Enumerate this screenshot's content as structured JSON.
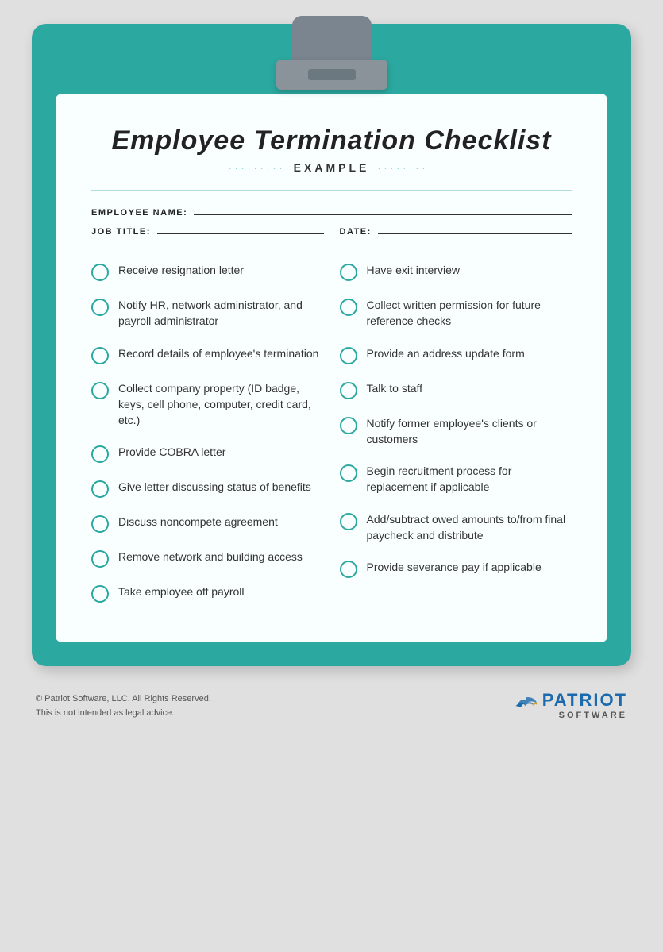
{
  "page": {
    "title": "Employee Termination Checklist",
    "subtitle": "EXAMPLE",
    "dots": "·········",
    "background_color": "#e0e0e0",
    "teal_color": "#2ba8a0"
  },
  "form_fields": {
    "employee_name_label": "EMPLOYEE NAME:",
    "job_title_label": "JOB TITLE:",
    "date_label": "DATE:"
  },
  "checklist": {
    "left_column": [
      {
        "id": "item-1",
        "text": "Receive resignation letter"
      },
      {
        "id": "item-2",
        "text": "Notify HR, network administrator, and payroll administrator"
      },
      {
        "id": "item-3",
        "text": "Record details of employee's termination"
      },
      {
        "id": "item-4",
        "text": "Collect company property (ID badge, keys, cell phone, computer, credit card, etc.)"
      },
      {
        "id": "item-5",
        "text": "Provide COBRA letter"
      },
      {
        "id": "item-6",
        "text": "Give letter discussing status of benefits"
      },
      {
        "id": "item-7",
        "text": "Discuss noncompete agreement"
      },
      {
        "id": "item-8",
        "text": "Remove network and building access"
      },
      {
        "id": "item-9",
        "text": "Take employee off payroll"
      }
    ],
    "right_column": [
      {
        "id": "item-10",
        "text": "Have exit interview"
      },
      {
        "id": "item-11",
        "text": "Collect written permission for future reference checks"
      },
      {
        "id": "item-12",
        "text": "Provide an address update form"
      },
      {
        "id": "item-13",
        "text": "Talk to staff"
      },
      {
        "id": "item-14",
        "text": "Notify former employee's clients or customers"
      },
      {
        "id": "item-15",
        "text": "Begin recruitment process for replacement if applicable"
      },
      {
        "id": "item-16",
        "text": "Add/subtract owed amounts to/from final paycheck and distribute"
      },
      {
        "id": "item-17",
        "text": "Provide severance pay if applicable"
      }
    ]
  },
  "footer": {
    "copyright": "© Patriot Software, LLC. All Rights Reserved.",
    "disclaimer": "This is not intended as legal advice.",
    "brand_name": "PATRIOT",
    "brand_sub": "SOFTWARE"
  }
}
